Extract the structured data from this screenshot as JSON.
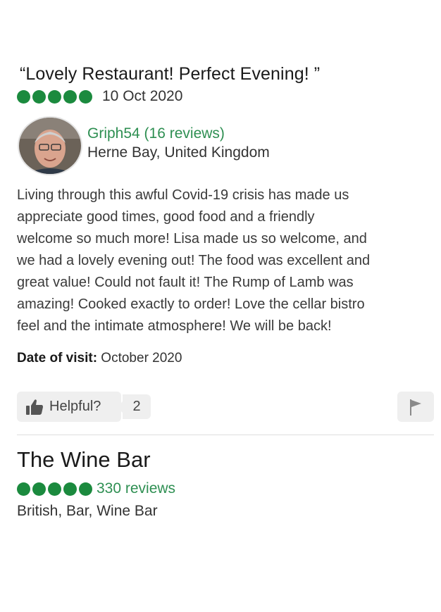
{
  "review": {
    "title": "“Lovely Restaurant! Perfect Evening! ”",
    "rating": 5,
    "rating_max": 5,
    "date": "10 Oct 2020",
    "reviewer": {
      "name": "Griph54 (16 reviews)",
      "location": "Herne Bay, United Kingdom"
    },
    "body_lines": [
      "Living through this awful Covid-19 crisis has made us",
      "appreciate good times, good food and a friendly",
      "welcome so much more! Lisa made us so welcome, and",
      "we had a lovely evening out! The food was excellent and",
      "great value! Could not fault it! The Rump of Lamb was",
      "amazing! Cooked exactly to order! Love the cellar bistro",
      "feel and the intimate atmosphere! We will be back!"
    ],
    "visit_label": "Date of visit:",
    "visit_value": " October 2020",
    "helpful_label": "Helpful?",
    "helpful_count": "2"
  },
  "restaurant": {
    "name": "The Wine Bar",
    "rating": 5,
    "rating_max": 5,
    "reviews": "330 reviews",
    "cuisine": "British, Bar, Wine Bar"
  },
  "colors": {
    "bubble": "#1b8a3e",
    "link": "#2e8f52"
  },
  "icons": {
    "helpful": "thumbs-up-icon",
    "report": "flag-icon"
  }
}
